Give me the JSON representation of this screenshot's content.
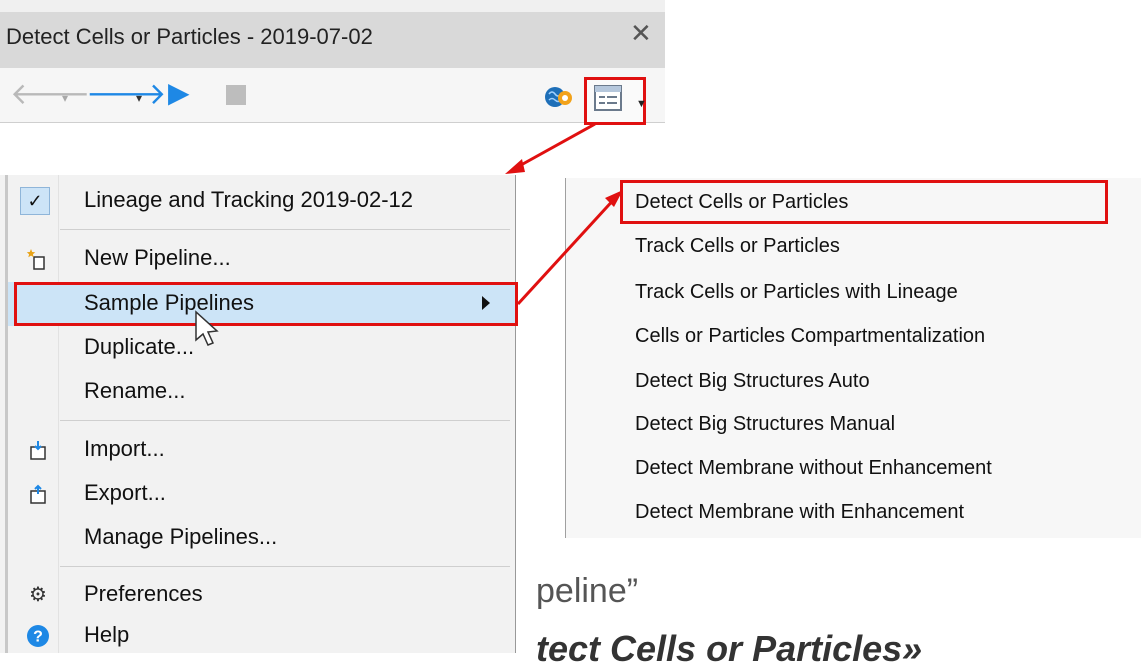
{
  "window": {
    "title": "Detect Cells or Particles - 2019-07-02",
    "close_glyph": "✕"
  },
  "toolbar": {
    "back_icon": "arrow-left-icon",
    "forward_icon": "arrow-right-icon",
    "run_icon": "play-icon",
    "stop_icon": "stop-icon",
    "brain_icon": "brain-gear-icon",
    "pipeline_menu_icon": "pipeline-menu-icon",
    "highlight_color": "#e01010",
    "accent_color": "#1e88e5"
  },
  "menu": {
    "current": {
      "label": "Lineage and Tracking  2019-02-12",
      "checked": true
    },
    "items": [
      {
        "label": "New Pipeline...",
        "icon": "new-pipeline-icon"
      },
      {
        "label": "Sample Pipelines",
        "has_submenu": true,
        "highlighted": true
      },
      {
        "label": "Duplicate..."
      },
      {
        "label": "Rename..."
      },
      {
        "label": "Import...",
        "icon": "import-icon"
      },
      {
        "label": "Export...",
        "icon": "export-icon"
      },
      {
        "label": "Manage Pipelines..."
      },
      {
        "label": "Preferences",
        "icon": "gear-icon"
      },
      {
        "label": "Help",
        "icon": "help-icon"
      }
    ]
  },
  "submenu": {
    "items": [
      "Detect Cells or Particles",
      "Track Cells or Particles",
      "Track Cells or Particles with Lineage",
      "Cells or Particles Compartmentalization",
      "Detect Big Structures Auto",
      "Detect Big Structures Manual",
      "Detect Membrane without Enhancement",
      "Detect Membrane with Enhancement"
    ],
    "highlighted_index": 0
  },
  "background_text": {
    "line1": "peline”",
    "line2": "tect Cells or Particles»"
  }
}
